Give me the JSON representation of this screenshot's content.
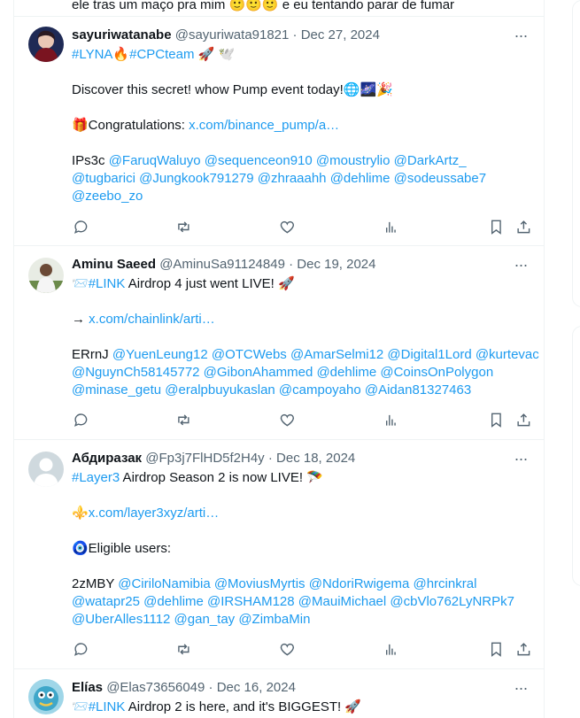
{
  "top_fragment": "ele tras um maço pra mim 🙂🙂🙂 e eu tentando parar de fumar",
  "tweets": [
    {
      "name": "sayuriwatanabe",
      "handle": "@sayuriwata91821",
      "sep": "·",
      "date": "Dec 27, 2024",
      "line1": {
        "a": "#LYNA",
        "b": "🔥",
        "c": "#CPCteam",
        "d": " 🚀 🕊️"
      },
      "line2": "Discover this secret! whow Pump event today!🌐🌌🎉",
      "line3": {
        "a": "🎁Congratulations: ",
        "b": "x.com/binance_pump/a…"
      },
      "line4": {
        "a": "IPs3c ",
        "b": "@FaruqWaluyo @sequenceon910 @moustrylio @DarkArtz_"
      },
      "line5": "@tugbarici @Jungkook791279 @zhraaahh @dehlime @sodeussabe7",
      "line6": "@zeebo_zo",
      "avatar_colors": [
        "#7a1420",
        "#1f2a55"
      ]
    },
    {
      "name": "Aminu Saeed",
      "handle": "@AminuSa91124849",
      "sep": "·",
      "date": "Dec 19, 2024",
      "line1": {
        "a": "📨",
        "b": "#LINK",
        "c": " Airdrop 4 just went LIVE! 🚀"
      },
      "line2": {
        "a": "→ ",
        "b": "x.com/chainlink/arti…"
      },
      "line3": {
        "a": "ERrnJ ",
        "b": "@YuenLeung12 @OTCWebs @AmarSelmi12 @Digital1Lord @kurtevac"
      },
      "line4": "@NguynCh58145772 @GibonAhammed @dehlime @CoinsOnPolygon",
      "line5": "@minase_getu @eralpbuyukaslan @campoyaho @Aidan81327463",
      "avatar_colors": [
        "#6b8a4a",
        "#e8ece4"
      ]
    },
    {
      "name": "Абдиразак",
      "handle": "@Fp3j7FlHD5f2H4y",
      "sep": "·",
      "date": "Dec 18, 2024",
      "line1": {
        "a": "#Layer3",
        "b": " Airdrop Season 2 is now LIVE! 🪂"
      },
      "line2": {
        "a": "⚜️",
        "b": "x.com/layer3xyz/arti…"
      },
      "line3": "🧿Eligible users:",
      "line4": {
        "a": "2zMBY ",
        "b": "@CiriloNamibia @MoviusMyrtis @NdoriRwigema @hrcinkral"
      },
      "line5": "@watapr25 @dehlime @IRSHAM128 @MauiMichael @cbVlo762LyNRPk7",
      "line6": "@UberAlles1112 @gan_tay @ZimbaMin",
      "avatar_colors": [
        "#cfd9de",
        "#ffffff"
      ]
    },
    {
      "name": "Elías",
      "handle": "@Elas73656049",
      "sep": "·",
      "date": "Dec 16, 2024",
      "line1": {
        "a": "📨",
        "b": "#LINK",
        "c": " Airdrop 2 is here, and it's BIGGEST! 🚀"
      },
      "avatar_colors": [
        "#3fa7c9",
        "#f2c94c"
      ]
    }
  ],
  "more_label": "···",
  "actions": [
    "reply-icon",
    "retweet-icon",
    "like-icon",
    "views-icon",
    "bookmark-icon",
    "share-icon"
  ],
  "colors": {
    "link": "#1d9bf0",
    "muted": "#536471",
    "text": "#0f1419",
    "border": "#eff3f4"
  }
}
